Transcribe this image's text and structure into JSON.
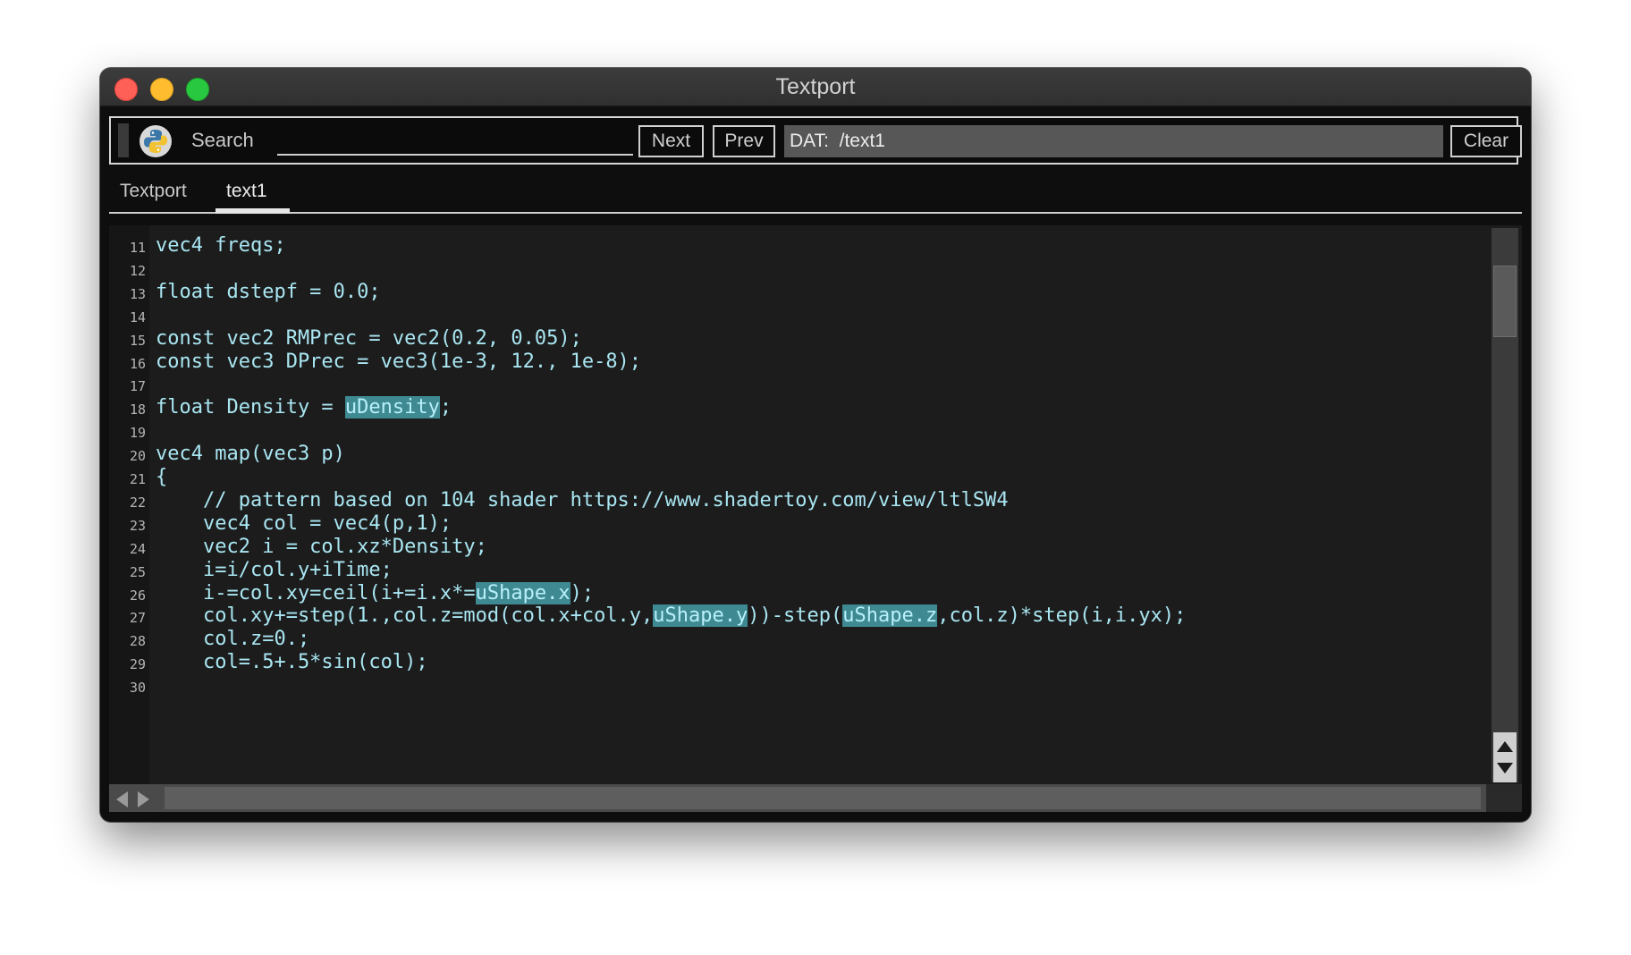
{
  "window": {
    "title": "Textport"
  },
  "toolbar": {
    "search_label": "Search",
    "search_value": "",
    "next_label": "Next",
    "prev_label": "Prev",
    "dat_text": "DAT:  /text1",
    "clear_label": "Clear",
    "logo_icon": "python-logo-icon"
  },
  "tabs": [
    {
      "label": "Textport",
      "active": false
    },
    {
      "label": "text1",
      "active": true
    }
  ],
  "editor": {
    "lines": [
      {
        "num": "11",
        "segments": [
          {
            "text": "vec4 freqs;"
          }
        ]
      },
      {
        "num": "12",
        "segments": [
          {
            "text": ""
          }
        ]
      },
      {
        "num": "13",
        "segments": [
          {
            "text": "float dstepf = 0.0;"
          }
        ]
      },
      {
        "num": "14",
        "segments": [
          {
            "text": ""
          }
        ]
      },
      {
        "num": "15",
        "segments": [
          {
            "text": "const vec2 RMPrec = vec2(0.2, 0.05);"
          }
        ]
      },
      {
        "num": "16",
        "segments": [
          {
            "text": "const vec3 DPrec = vec3(1e-3, 12., 1e-8);"
          }
        ]
      },
      {
        "num": "17",
        "segments": [
          {
            "text": ""
          }
        ]
      },
      {
        "num": "18",
        "segments": [
          {
            "text": "float Density = "
          },
          {
            "text": "uDensity",
            "hl": true
          },
          {
            "text": ";"
          }
        ]
      },
      {
        "num": "19",
        "segments": [
          {
            "text": ""
          }
        ]
      },
      {
        "num": "20",
        "segments": [
          {
            "text": "vec4 map(vec3 p)"
          }
        ]
      },
      {
        "num": "21",
        "segments": [
          {
            "text": "{"
          }
        ]
      },
      {
        "num": "22",
        "segments": [
          {
            "text": "    // pattern based on 104 shader https://www.shadertoy.com/view/ltlSW4"
          }
        ]
      },
      {
        "num": "23",
        "segments": [
          {
            "text": "    vec4 col = vec4(p,1);"
          }
        ]
      },
      {
        "num": "24",
        "segments": [
          {
            "text": "    vec2 i = col.xz*Density;"
          }
        ]
      },
      {
        "num": "25",
        "segments": [
          {
            "text": "    i=i/col.y+iTime;"
          }
        ]
      },
      {
        "num": "26",
        "segments": [
          {
            "text": "    i-=col.xy=ceil(i+=i.x*="
          },
          {
            "text": "uShape.x",
            "hl": true
          },
          {
            "text": ");"
          }
        ]
      },
      {
        "num": "27",
        "segments": [
          {
            "text": "    col.xy+=step(1.,col.z=mod(col.x+col.y,"
          },
          {
            "text": "uShape.y",
            "hl": true
          },
          {
            "text": "))-step("
          },
          {
            "text": "uShape.z",
            "hl": true
          },
          {
            "text": ",col.z)*step(i,i.yx);"
          }
        ]
      },
      {
        "num": "28",
        "segments": [
          {
            "text": "    col.z=0.;"
          }
        ]
      },
      {
        "num": "29",
        "segments": [
          {
            "text": "    col=.5+.5*sin(col);"
          }
        ]
      },
      {
        "num": "30",
        "segments": [
          {
            "text": ""
          }
        ]
      }
    ],
    "highlight_color": "#3f8a92",
    "code_color": "#a9e6f2"
  }
}
